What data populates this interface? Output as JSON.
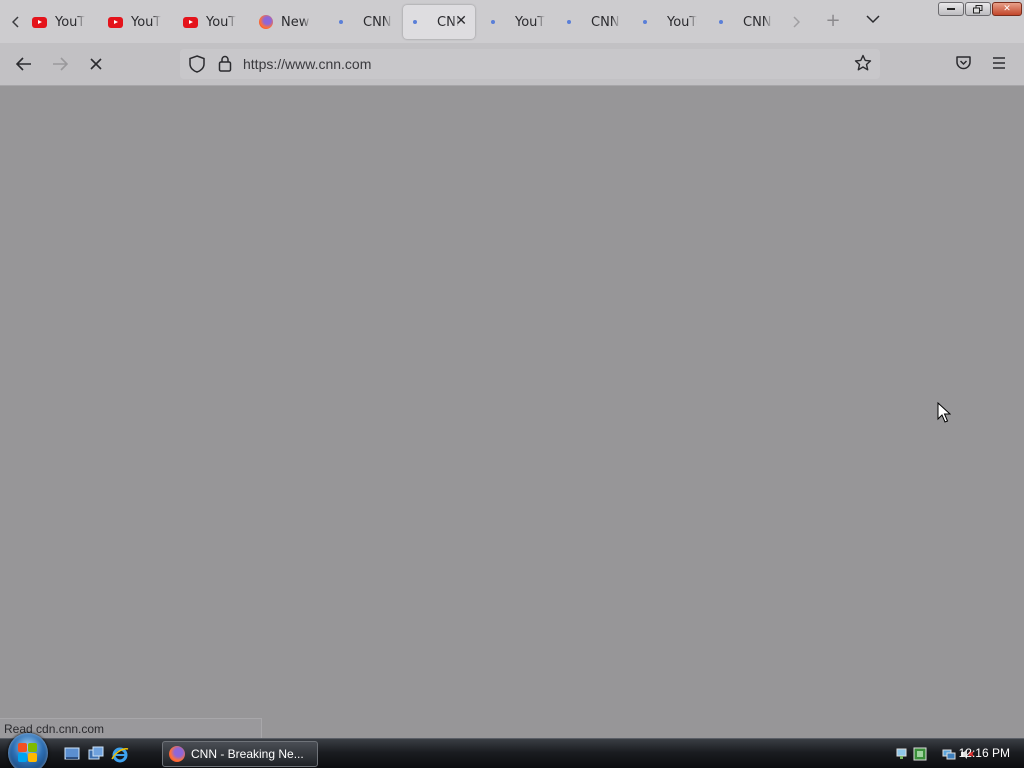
{
  "browser": {
    "tabs": [
      {
        "title": "YouT",
        "icon": "youtube-icon",
        "active": false
      },
      {
        "title": "YouT",
        "icon": "youtube-icon",
        "active": false
      },
      {
        "title": "YouT",
        "icon": "youtube-icon",
        "active": false
      },
      {
        "title": "New T",
        "icon": "firefox-icon",
        "active": false
      },
      {
        "title": "CNN",
        "icon": "loading-dot-icon",
        "active": false
      },
      {
        "title": "CNN",
        "icon": "loading-dot-icon",
        "active": true
      },
      {
        "title": "YouT",
        "icon": "loading-dot-icon",
        "active": false
      },
      {
        "title": "CNN",
        "icon": "loading-dot-icon",
        "active": false
      },
      {
        "title": "YouTu",
        "icon": "loading-dot-icon",
        "active": false
      },
      {
        "title": "CNN",
        "icon": "loading-dot-icon",
        "active": false
      }
    ],
    "url": "https://www.cnn.com",
    "status_text": "Read cdn.cnn.com"
  },
  "taskbar": {
    "window_button_label": "CNN - Breaking Ne...",
    "clock": "12:16 PM"
  },
  "colors": {
    "content_bg": "#979698",
    "tabstrip_bg": "#cdcccf",
    "youtube_red": "#e4131b"
  }
}
